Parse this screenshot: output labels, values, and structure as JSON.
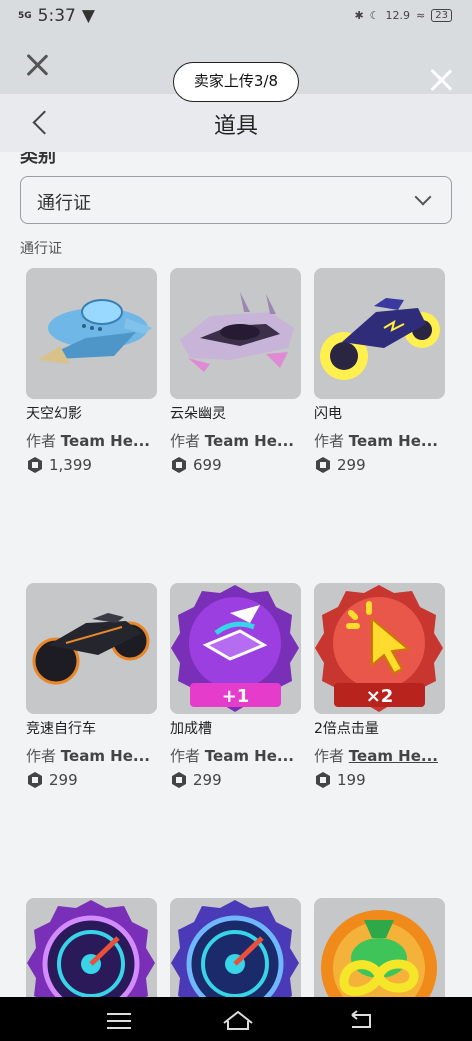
{
  "status_bar": {
    "network": "5G",
    "time": "5:37",
    "battery": "23",
    "speed": "12.9"
  },
  "overlay": {
    "seller_upload": "卖家上传3/8"
  },
  "header": {
    "title": "道具"
  },
  "filter": {
    "category_label": "类别",
    "selected": "通行证"
  },
  "section_title": "通行证",
  "creator_prefix": "作者",
  "items": [
    {
      "name": "天空幻影",
      "creator": "Team He...",
      "price": "1,399"
    },
    {
      "name": "云朵幽灵",
      "creator": "Team He...",
      "price": "699"
    },
    {
      "name": "闪电",
      "creator": "Team He...",
      "price": "299"
    },
    {
      "name": "竞速自行车",
      "creator": "Team He...",
      "price": "299"
    },
    {
      "name": "加成槽",
      "creator": "Team He...",
      "price": "299"
    },
    {
      "name": "2倍点击量",
      "creator": "Team He...",
      "price": "199"
    },
    {
      "name": "",
      "creator": "",
      "price": ""
    },
    {
      "name": "",
      "creator": "",
      "price": ""
    },
    {
      "name": "",
      "creator": "",
      "price": ""
    }
  ],
  "badges": {
    "boost": "+1",
    "double": "×2"
  },
  "colors": {
    "accent": "#ffffff",
    "tile_bg": "#c6c7c9",
    "page_bg": "#f2f3f5"
  }
}
